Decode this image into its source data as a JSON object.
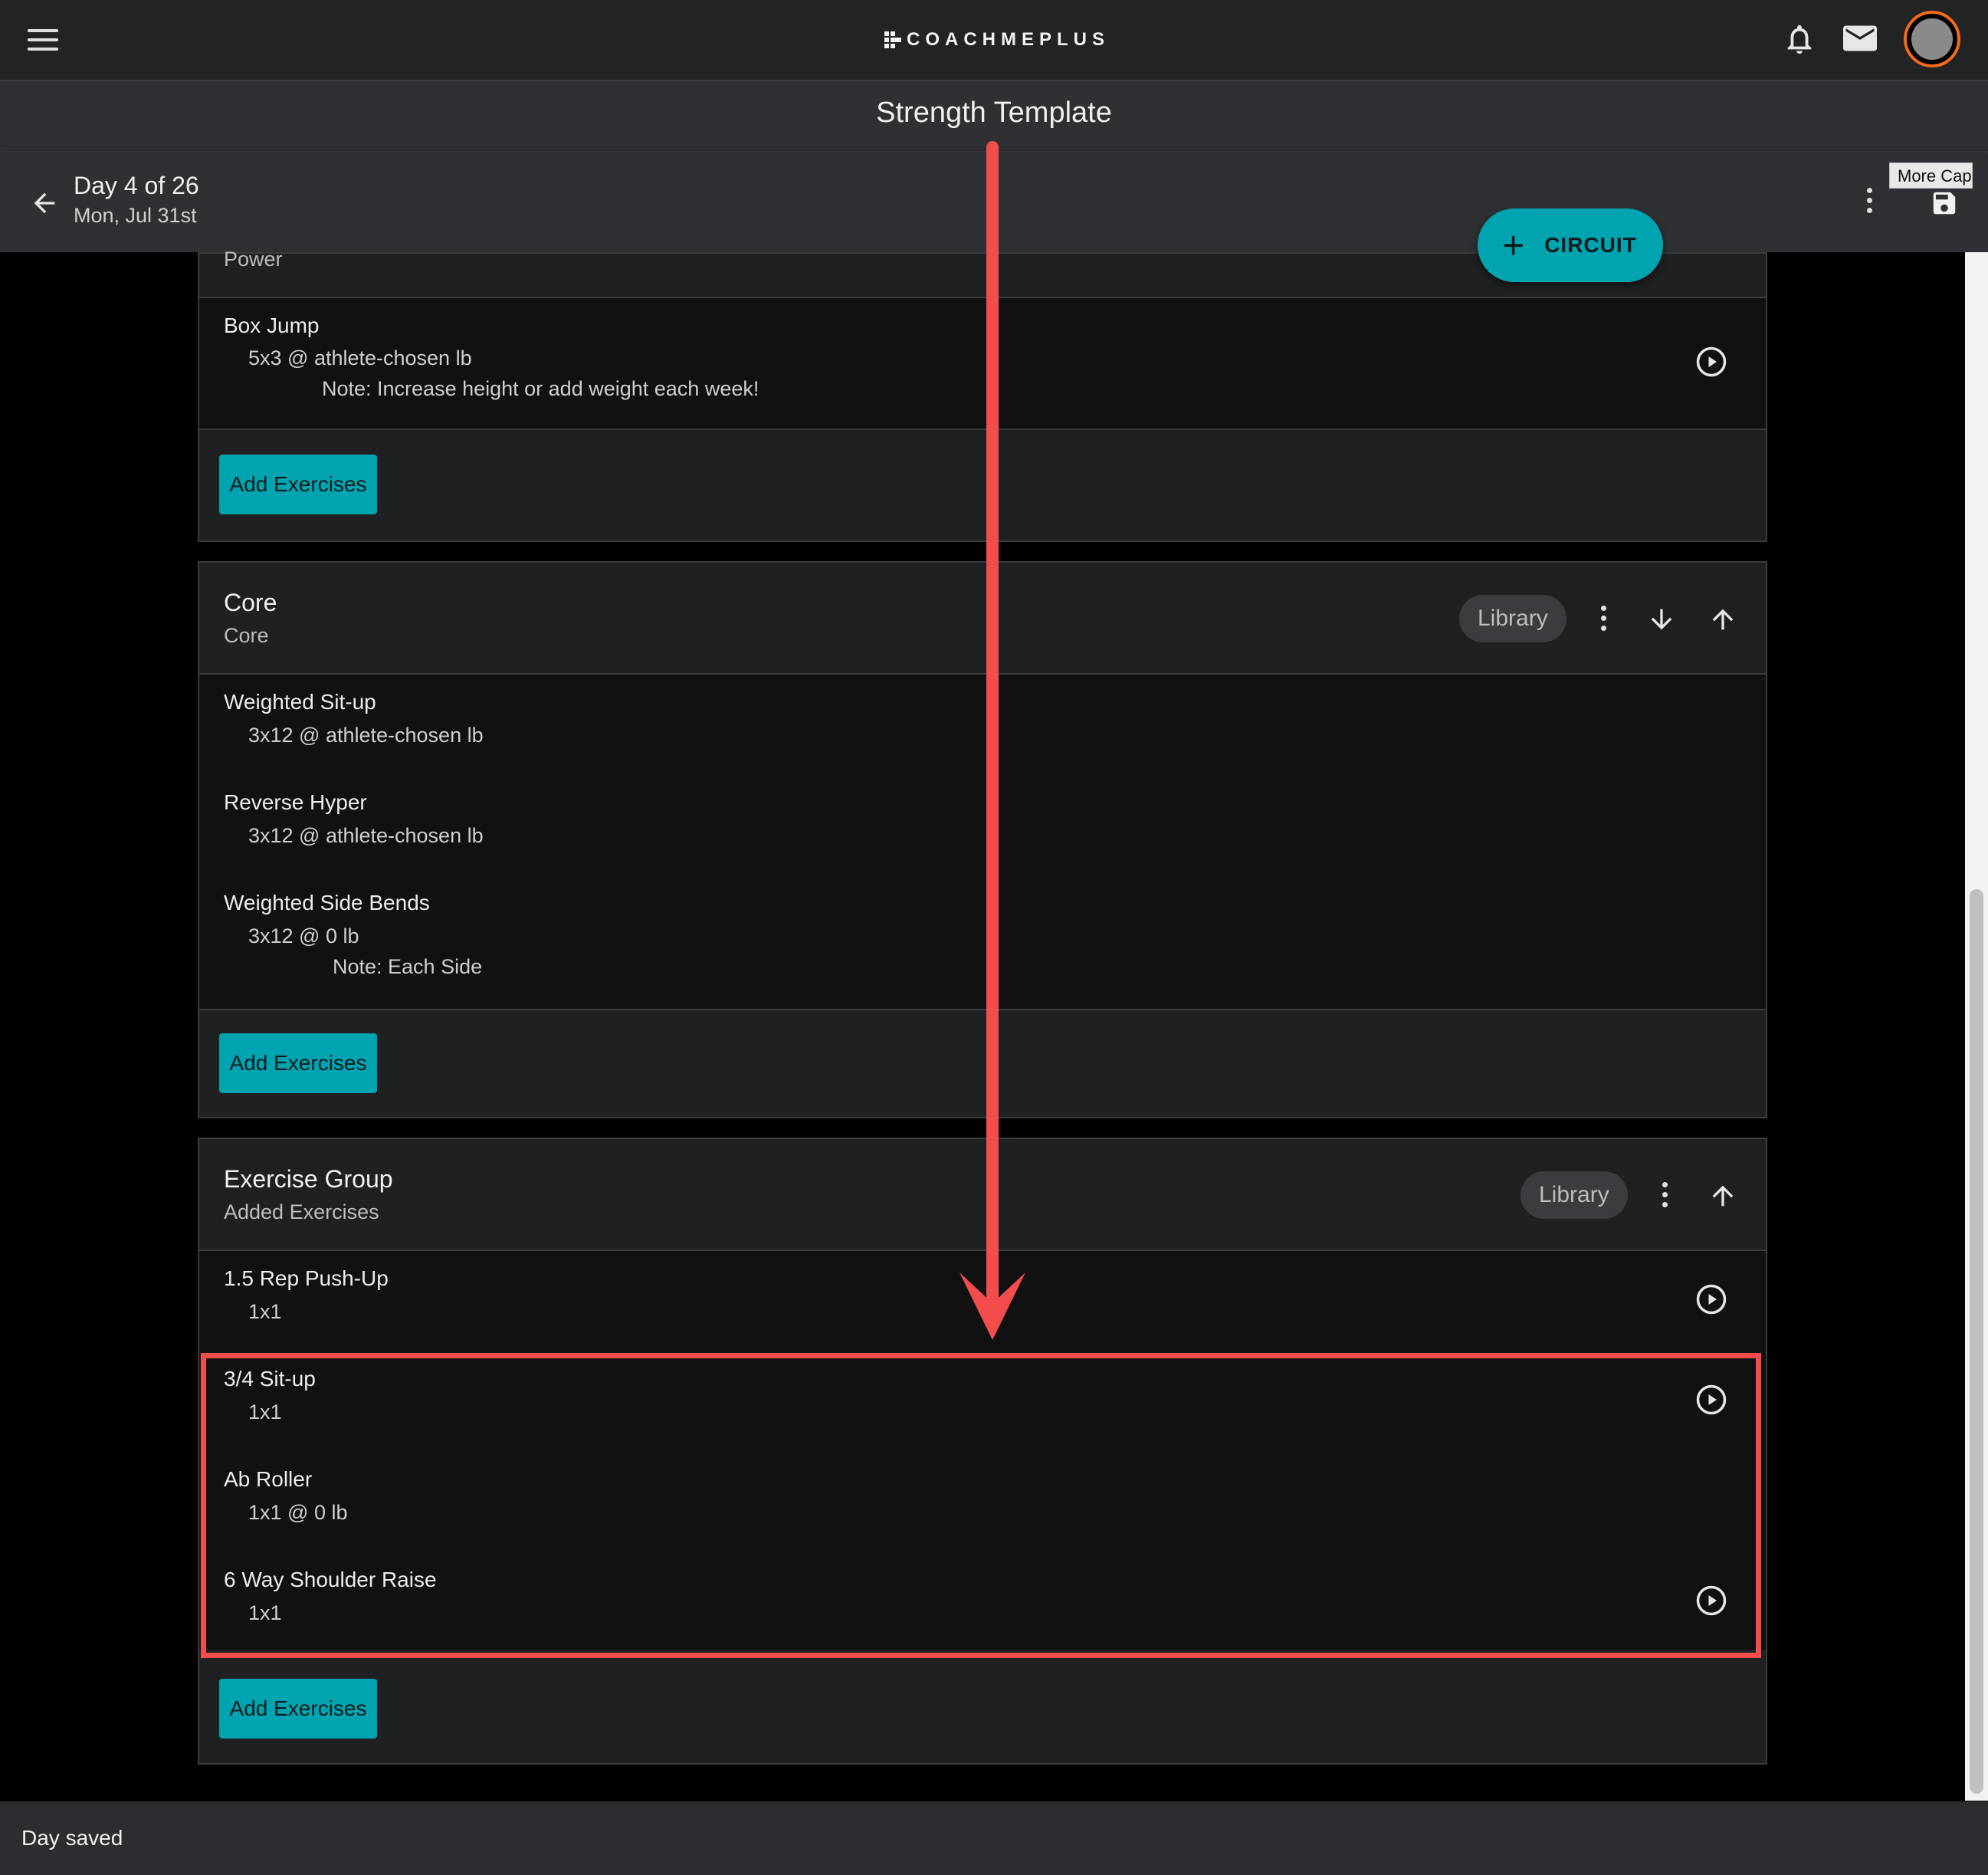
{
  "app": {
    "logo_text": "COACHMEPLUS",
    "page_title": "Strength Template",
    "tooltip": "More Capture"
  },
  "day": {
    "title": "Day 4 of 26",
    "date": "Mon, Jul 31st"
  },
  "circuit_button": {
    "label": "CIRCUIT"
  },
  "groups": [
    {
      "sub": "Power",
      "exercises": [
        {
          "name": "Box Jump",
          "detail": "5x3  @ athlete-chosen lb",
          "note": "Note: Increase height or add weight each week!"
        }
      ],
      "add_label": "Add Exercises"
    },
    {
      "title": "Core",
      "sub": "Core",
      "library_label": "Library",
      "exercises": [
        {
          "name": "Weighted Sit-up",
          "detail": "3x12  @ athlete-chosen lb"
        },
        {
          "name": "Reverse Hyper",
          "detail": "3x12  @ athlete-chosen lb"
        },
        {
          "name": "Weighted Side Bends",
          "detail": "3x12  @ 0 lb",
          "note": "Note: Each Side"
        }
      ],
      "add_label": "Add Exercises"
    },
    {
      "title": "Exercise Group",
      "sub": "Added Exercises",
      "library_label": "Library",
      "exercises": [
        {
          "name": "1.5 Rep Push-Up",
          "detail": "1x1"
        },
        {
          "name": "3/4 Sit-up",
          "detail": "1x1"
        },
        {
          "name": "Ab Roller",
          "detail": "1x1  @ 0 lb"
        },
        {
          "name": "6 Way Shoulder Raise",
          "detail": "1x1"
        }
      ],
      "add_label": "Add Exercises"
    }
  ],
  "snackbar": {
    "text": "Day saved"
  },
  "colors": {
    "accent": "#00a4b0",
    "annotation": "#f34c4c",
    "avatar_ring": "#f36a1a"
  }
}
